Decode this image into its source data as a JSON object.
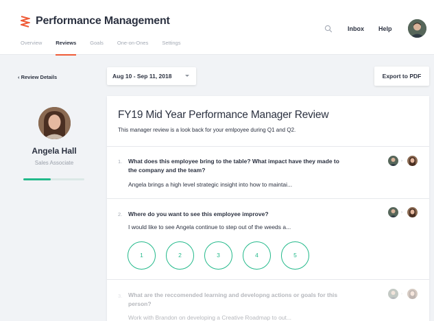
{
  "header": {
    "app_title": "Performance Management",
    "tabs": [
      {
        "label": "Overview",
        "active": false
      },
      {
        "label": "Reviews",
        "active": true
      },
      {
        "label": "Goals",
        "active": false
      },
      {
        "label": "One-on-Ones",
        "active": false
      },
      {
        "label": "Settings",
        "active": false
      }
    ],
    "inbox_label": "Inbox",
    "help_label": "Help"
  },
  "sidebar": {
    "back_label": "Review Details",
    "profile_name": "Angela Hall",
    "profile_role": "Sales Associate",
    "progress_fraction": 0.45
  },
  "toolbar": {
    "date_range": "Aug 10 - Sep 11, 2018",
    "export_label": "Export to PDF"
  },
  "review": {
    "title": "FY19 Mid Year Performance Manager Review",
    "description": "This manager review is a look back for your emlpoyee during Q1 and Q2.",
    "questions": [
      {
        "number": "1.",
        "text": "What does this employee bring to the table? What impact have they made to the company and the team?",
        "answer": "Angela brings a high level strategic insight into how to maintai..."
      },
      {
        "number": "2.",
        "text": "Where do you want to see this employee improve?",
        "answer": "I would like to see Angela continue to step out of the weeds a...",
        "ratings": [
          "1",
          "2",
          "3",
          "4",
          "5"
        ]
      },
      {
        "number": "3.",
        "text": "What are the reccomended learning and developng actions or goals for this person?",
        "answer": "Work with Brandon on developing a Creative Roadmap to out..."
      }
    ]
  },
  "colors": {
    "accent": "#ef5a36",
    "success": "#22b98a",
    "text": "#2b3140",
    "muted": "#a3a9b4"
  },
  "icons": [
    "brand-logo-icon",
    "search-icon",
    "chevron-left-icon",
    "caret-down-icon",
    "arrow-right-icon"
  ]
}
